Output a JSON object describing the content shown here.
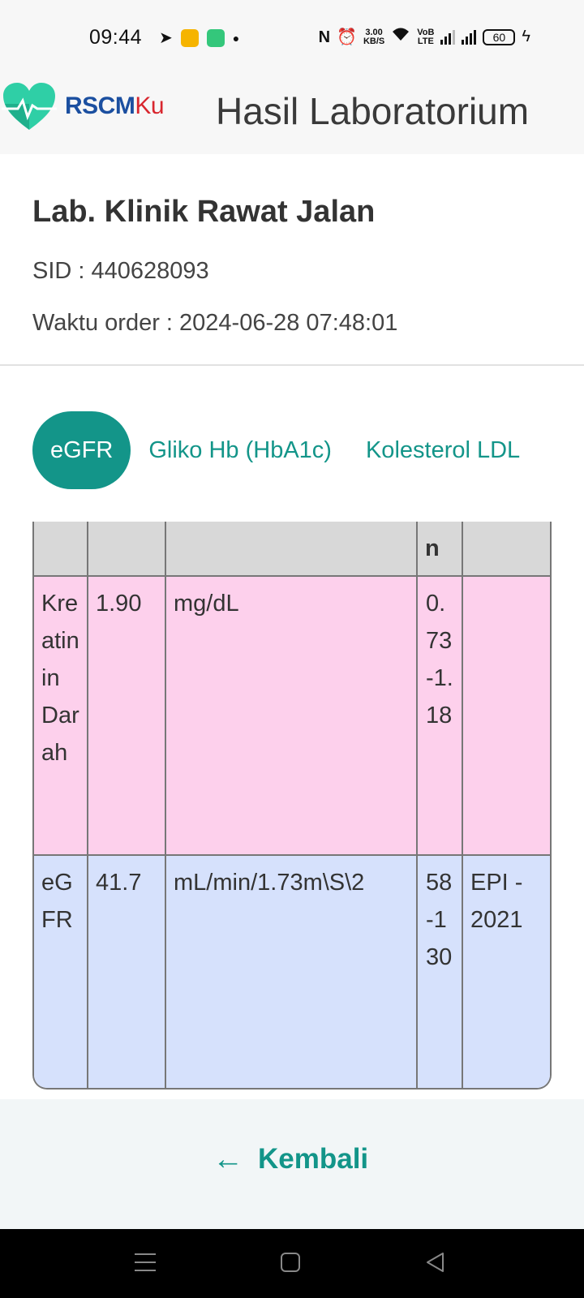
{
  "status_bar": {
    "time": "09:44",
    "net_speed_value": "3.00",
    "net_speed_unit": "KB/S",
    "volte_label_top": "VoB",
    "volte_label_bottom": "LTE",
    "battery": "60",
    "icons": [
      "telegram-icon",
      "app-badge-icon",
      "battery-saver-icon",
      "dot-icon",
      "nfc-icon",
      "alarm-icon",
      "wifi-icon",
      "signal-icon",
      "signal-icon",
      "charging-icon"
    ]
  },
  "header": {
    "logo_part1": "RSCM",
    "logo_part2": "Ku",
    "title": "Hasil Laboratorium"
  },
  "info": {
    "title": "Lab. Klinik Rawat Jalan",
    "sid": "SID : 440628093",
    "order_time": "Waktu order : 2024-06-28 07:48:01"
  },
  "tabs": [
    {
      "label": "eGFR",
      "active": true
    },
    {
      "label": "Gliko Hb (HbA1c)",
      "active": false
    },
    {
      "label": "Kolesterol LDL",
      "active": false
    }
  ],
  "table": {
    "header_partial": [
      "",
      "",
      "",
      "n",
      ""
    ],
    "rows": [
      {
        "test": "Kreatinin Darah",
        "value": "1.90",
        "unit": "mg/dL",
        "range": "0.73-1.18",
        "method": ""
      },
      {
        "test": "eGFR",
        "value": "41.7",
        "unit": "mL/min/1.73m\\S\\2",
        "range": "58-130",
        "method": "EPI - 2021"
      }
    ]
  },
  "footer": {
    "back_label": "Kembali"
  },
  "colors": {
    "accent": "#139589",
    "row_high": "#fdd0ec",
    "row_low": "#d6e1fc",
    "header_row": "#d8d8d8",
    "logo_blue": "#1b4fa0",
    "logo_red": "#d8262e"
  }
}
